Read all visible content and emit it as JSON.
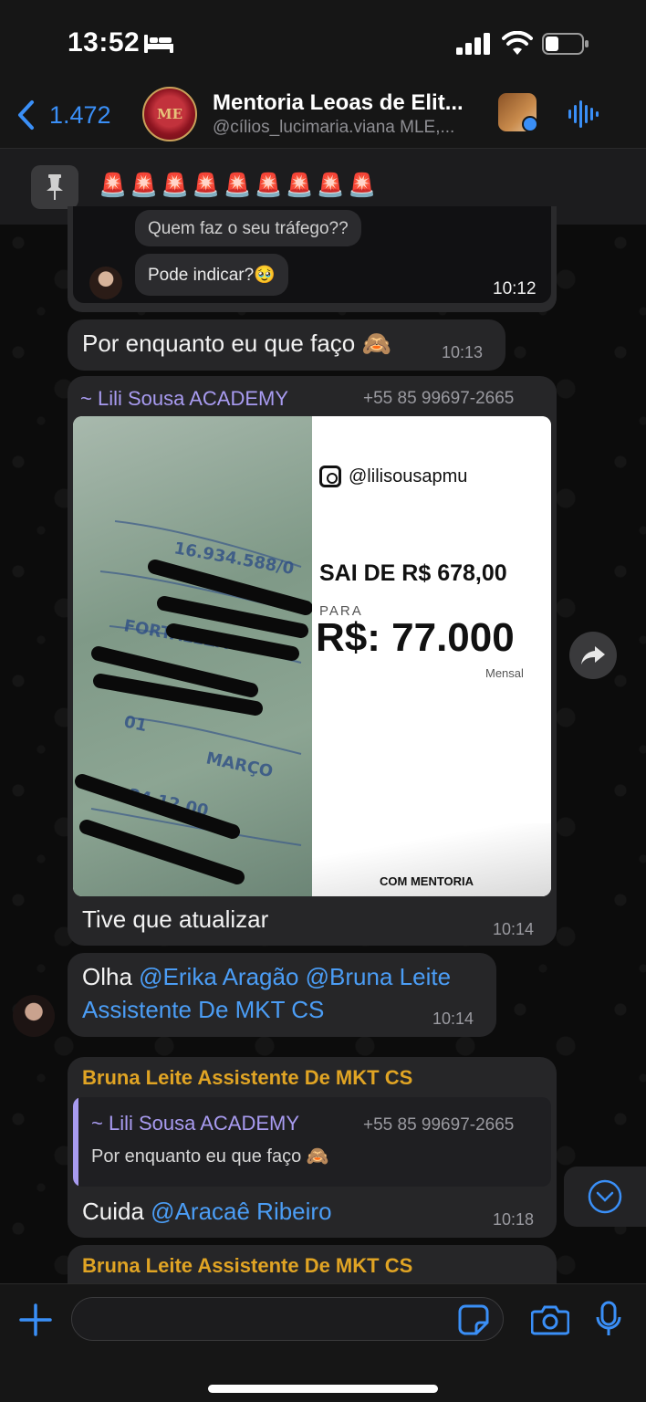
{
  "status_bar": {
    "time": "13:52"
  },
  "header": {
    "back_count": "1.472",
    "avatar_monogram": "ME",
    "title": "Mentoria Leoas de Elit...",
    "subtitle": "@cílios_lucimaria.viana MLE,..."
  },
  "pinned": {
    "text": "🚨🚨🚨🚨🚨🚨🚨🚨🚨"
  },
  "messages": {
    "prev_card": {
      "partial_line": "Quem faz o seu tráfego??",
      "question": "Pode indicar?🥹",
      "time": "10:12"
    },
    "reply1": {
      "text": "Por enquanto eu que faço 🙈",
      "time": "10:13"
    },
    "forwarded": {
      "sender": "~ Lili Sousa ACADEMY",
      "phone": "+55 85 99697-2665",
      "image": {
        "handle": "@lilisousapmu",
        "sai": "SAI DE R$ 678,00",
        "para": "PARA",
        "value": "R$: 77.000",
        "mensal": "Mensal",
        "footer": "COM MENTORIA"
      },
      "caption": "Tive que atualizar",
      "time": "10:14"
    },
    "olha": {
      "word": "Olha",
      "mention1": "@Erika Aragão",
      "mention2": "@Bruna Leite",
      "line2": "Assistente De MKT CS",
      "time": "10:14"
    },
    "bruna1": {
      "sender": "Bruna Leite Assistente De MKT CS",
      "quote_sender": "~ Lili Sousa ACADEMY",
      "quote_phone": "+55 85 99697-2665",
      "quote_text": "Por enquanto eu que faço 🙈",
      "text": "Cuida",
      "mention": "@Aracaê Ribeiro",
      "time": "10:18"
    },
    "bruna2": {
      "sender": "Bruna Leite Assistente De MKT CS"
    }
  },
  "colors": {
    "accent_blue": "#3a8ff7",
    "mention_blue": "#4b9df5",
    "sender_purple": "#a89bf0",
    "sender_gold": "#e0a424",
    "bubble_bg": "#262628"
  }
}
